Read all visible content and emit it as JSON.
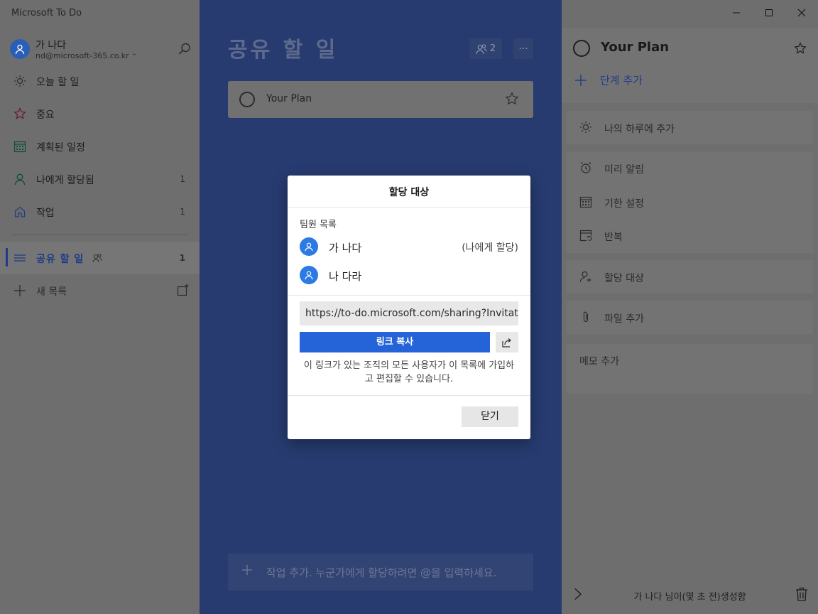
{
  "app": {
    "title": "Microsoft To Do"
  },
  "user": {
    "name": "가 나다",
    "email": "nd@microsoft-365.co.kr"
  },
  "nav": {
    "items": [
      {
        "label": "오늘 할 일",
        "count": ""
      },
      {
        "label": "중요",
        "count": ""
      },
      {
        "label": "계획된 일정",
        "count": ""
      },
      {
        "label": "나에게 할당됨",
        "count": "1"
      },
      {
        "label": "작업",
        "count": "1"
      }
    ],
    "shared_list": {
      "label": "공유 할 일",
      "count": "1"
    },
    "new_list": "새 목록"
  },
  "main": {
    "list_title": "공유 할 일",
    "share_count": "2",
    "more": "···",
    "tasks": [
      {
        "title": "Your Plan"
      }
    ],
    "add_task_placeholder": "작업 추가. 누군가에게 할당하려면 @을 입력하세요."
  },
  "detail": {
    "title": "Your Plan",
    "add_step": "단계 추가",
    "my_day": "나의 하루에 추가",
    "remind": "미리 알림",
    "due": "기한 설정",
    "repeat": "반복",
    "assign": "할당 대상",
    "add_file": "파일 추가",
    "memo": "메모 추가",
    "footer": "가 나다 님이(몇 초 전)생성함"
  },
  "modal": {
    "title": "할당 대상",
    "members_label": "팀원 목록",
    "members": [
      {
        "name": "가 나다",
        "note": "(나에게 할당)"
      },
      {
        "name": "나 다라",
        "note": ""
      }
    ],
    "link": "https://to-do.microsoft.com/sharing?Invitation",
    "copy_link": "링크 복사",
    "description": "이 링크가 있는 조직의 모든 사용자가 이 목록에 가입하고 편집할 수 있습니다.",
    "close": "닫기"
  },
  "colors": {
    "accent": "#2564d8",
    "list_theme": "#273b70",
    "avatar": "#2c7be5"
  }
}
